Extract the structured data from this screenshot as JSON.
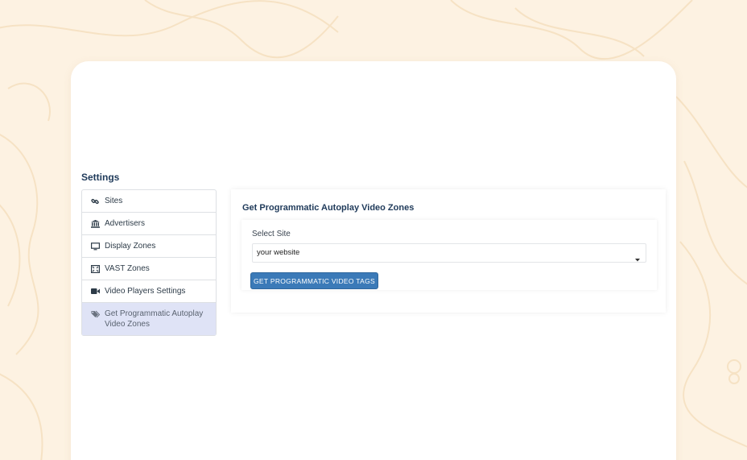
{
  "sidebar": {
    "title": "Settings",
    "items": [
      {
        "label": "Sites",
        "icon": "link-icon"
      },
      {
        "label": "Advertisers",
        "icon": "bank-icon"
      },
      {
        "label": "Display Zones",
        "icon": "monitor-icon"
      },
      {
        "label": "VAST Zones",
        "icon": "vast-icon"
      },
      {
        "label": "Video Players Settings",
        "icon": "video-camera-icon"
      },
      {
        "label": "Get Programmatic Autoplay Video Zones",
        "icon": "tags-icon",
        "active": true
      }
    ]
  },
  "main": {
    "title": "Get Programmatic Autoplay Video Zones",
    "select_label": "Select Site",
    "select_value": "your website",
    "button_label": "GET PROGRAMMATIC VIDEO TAGS"
  },
  "colors": {
    "background": "#fdf2e2",
    "accent": "#3b7ab8",
    "active_item": "#dfe3f6",
    "heading": "#1f3a5a"
  }
}
